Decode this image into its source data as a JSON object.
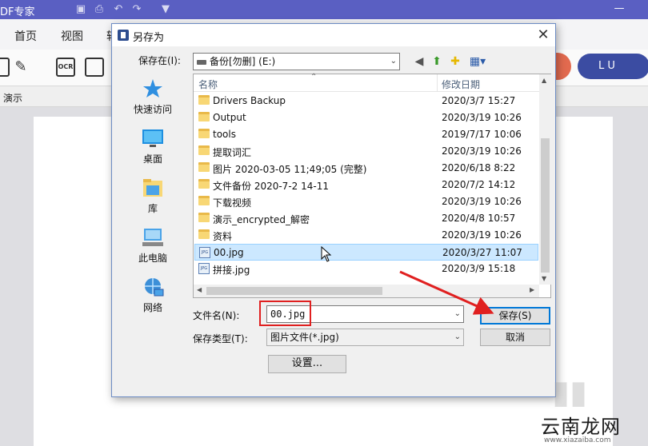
{
  "app": {
    "title": "DF专家",
    "qa_icons": [
      "save-icon",
      "print-icon",
      "undo-icon",
      "redo-icon",
      "dropdown-icon"
    ],
    "window_controls": {
      "minimize": "—",
      "close": "✕"
    },
    "menu": [
      "首页",
      "视图",
      "转"
    ],
    "login_label": "L U",
    "subbar_label": "演示",
    "accent_color": "#5a5fc2",
    "login_color": "#3b4ca2"
  },
  "dialog": {
    "title": "另存为",
    "save_in_label": "保存在(I):",
    "save_in_value": "备份[勿删] (E:)",
    "places": [
      {
        "label": "快速访问",
        "icon": "star-icon"
      },
      {
        "label": "桌面",
        "icon": "desktop-icon"
      },
      {
        "label": "库",
        "icon": "library-icon"
      },
      {
        "label": "此电脑",
        "icon": "computer-icon"
      },
      {
        "label": "网络",
        "icon": "network-icon"
      }
    ],
    "columns": {
      "name": "名称",
      "date": "修改日期"
    },
    "files": [
      {
        "name": "Drivers Backup",
        "date": "2020/3/7 15:27",
        "type": "folder"
      },
      {
        "name": "Output",
        "date": "2020/3/19 10:26",
        "type": "folder"
      },
      {
        "name": "tools",
        "date": "2019/7/17 10:06",
        "type": "folder"
      },
      {
        "name": "提取词汇",
        "date": "2020/3/19 10:26",
        "type": "folder"
      },
      {
        "name": "图片 2020-03-05 11;49;05 (完整)",
        "date": "2020/6/18 8:22",
        "type": "folder"
      },
      {
        "name": "文件备份 2020-7-2 14-11",
        "date": "2020/7/2 14:12",
        "type": "folder"
      },
      {
        "name": "下载视频",
        "date": "2020/3/19 10:26",
        "type": "folder"
      },
      {
        "name": "演示_encrypted_解密",
        "date": "2020/4/8 10:57",
        "type": "folder"
      },
      {
        "name": "资料",
        "date": "2020/3/19 10:26",
        "type": "folder"
      },
      {
        "name": "00.jpg",
        "date": "2020/3/27 11:07",
        "type": "jpg",
        "selected": true
      },
      {
        "name": "拼接.jpg",
        "date": "2020/3/9 15:18",
        "type": "jpg"
      }
    ],
    "filename_label": "文件名(N):",
    "filename_value": "00.jpg",
    "filetype_label": "保存类型(T):",
    "filetype_value": "图片文件(*.jpg)",
    "save_button": "保存(S)",
    "cancel_button": "取消",
    "settings_button": "设置...",
    "highlight_color": "#e02020"
  },
  "watermark": {
    "brand": "云南龙网",
    "sub": "www.xiazaiba.com"
  }
}
